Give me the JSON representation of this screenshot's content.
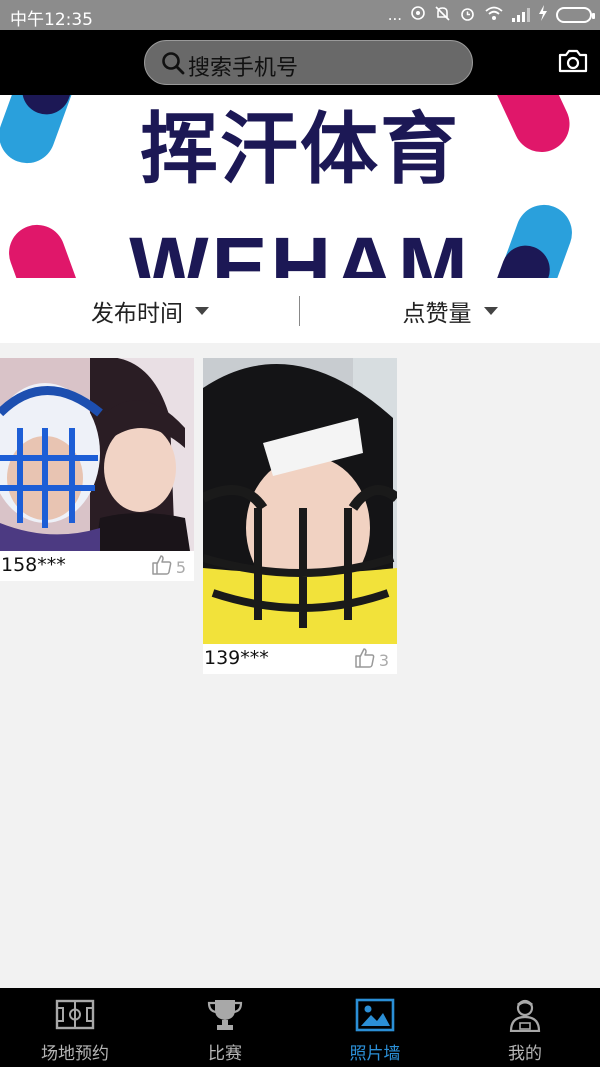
{
  "status_bar": {
    "time": "中午12:35",
    "dots": "...",
    "icons": [
      "hotspot-icon",
      "mute-icon",
      "alarm-icon",
      "wifi-icon",
      "signal-icon",
      "charging-icon",
      "battery-icon"
    ]
  },
  "header": {
    "search_placeholder": "搜索手机号",
    "camera_icon": "camera-icon"
  },
  "banner": {
    "title_cn": "挥汗体育",
    "title_en": "WEHAM",
    "colors": {
      "text": "#1c1855",
      "pink": "#e0176a",
      "blue": "#2aa0dc"
    }
  },
  "sort": {
    "publish_time": "发布时间",
    "likes": "点赞量"
  },
  "photos": [
    {
      "phone": "158***",
      "likes": "5"
    },
    {
      "phone": "139***",
      "likes": "3"
    }
  ],
  "bottom_nav": {
    "items": [
      {
        "label": "场地预约",
        "icon": "field-icon"
      },
      {
        "label": "比赛",
        "icon": "trophy-icon"
      },
      {
        "label": "照片墙",
        "icon": "photo-icon",
        "active": true
      },
      {
        "label": "我的",
        "icon": "profile-icon"
      }
    ],
    "accent": "#2b8fd6"
  }
}
